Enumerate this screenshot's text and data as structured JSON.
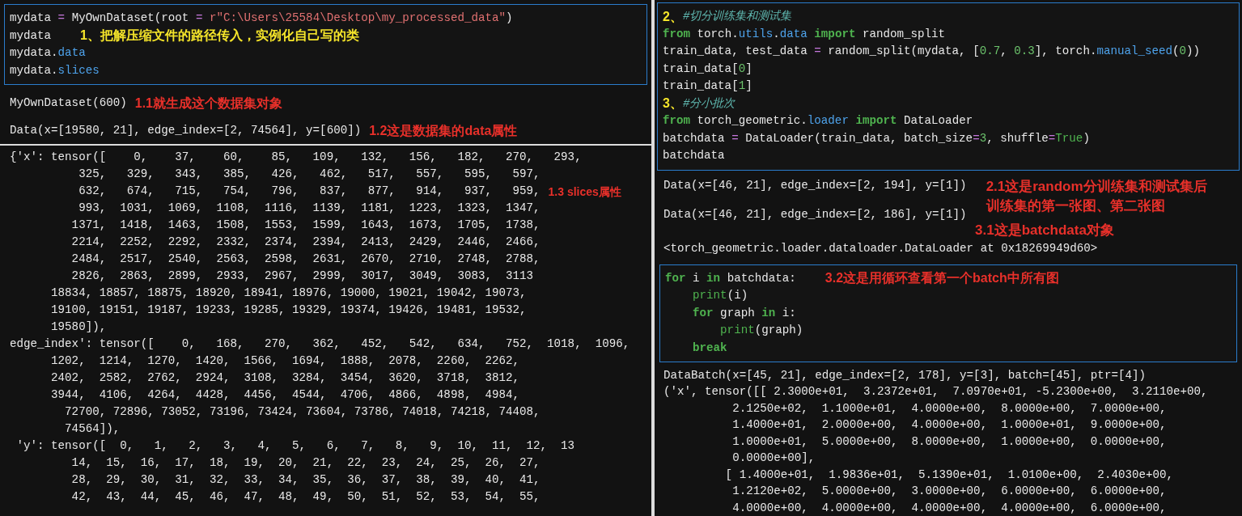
{
  "left": {
    "cell": {
      "lines": [
        {
          "tokens": [
            {
              "t": "mydata ",
              "kind": "plain"
            },
            {
              "t": "=",
              "kind": "op"
            },
            {
              "t": " MyOwnDataset(root ",
              "kind": "plain"
            },
            {
              "t": "=",
              "kind": "op"
            },
            {
              "t": " r\"C:\\Users\\25584\\Desktop\\my_processed_data\"",
              "kind": "str"
            },
            {
              "t": ")",
              "kind": "plain"
            }
          ]
        },
        {
          "tokens": [
            {
              "t": "mydata",
              "kind": "plain"
            }
          ],
          "note": {
            "text": "1、把解压缩文件的路径传入，实例化自己写的类",
            "color": "#f5e52a"
          }
        },
        {
          "tokens": [
            {
              "t": "mydata.",
              "kind": "plain"
            },
            {
              "t": "data",
              "kind": "attr"
            }
          ]
        },
        {
          "tokens": [
            {
              "t": "mydata.",
              "kind": "plain"
            },
            {
              "t": "slices",
              "kind": "attr"
            }
          ]
        }
      ]
    },
    "outputs": [
      {
        "text": "MyOwnDataset(600)",
        "note": {
          "text": "1.1就生成这个数据集对象",
          "color": "#e8302a"
        }
      },
      {
        "text": "Data(x=[19580, 21], edge_index=[2, 74564], y=[600])",
        "note": {
          "text": "1.2这是数据集的data属性",
          "color": "#e8302a"
        }
      }
    ],
    "slices": [
      {
        "text": "{'x': tensor([    0,    37,    60,    85,   109,   132,   156,   182,   270,   293,"
      },
      {
        "text": "          325,   329,   343,   385,   426,   462,   517,   557,   595,   597,"
      },
      {
        "text": "          632,   674,   715,   754,   796,   837,   877,   914,   937,   959,",
        "note": {
          "text": "1.3 slices属性",
          "color": "#e8302a"
        }
      },
      {
        "text": "          993,  1031,  1069,  1108,  1116,  1139,  1181,  1223,  1323,  1347,"
      },
      {
        "text": "         1371,  1418,  1463,  1508,  1553,  1599,  1643,  1673,  1705,  1738,"
      },
      {
        "text": "         2214,  2252,  2292,  2332,  2374,  2394,  2413,  2429,  2446,  2466,"
      },
      {
        "text": "         2484,  2517,  2540,  2563,  2598,  2631,  2670,  2710,  2748,  2788,"
      },
      {
        "text": "         2826,  2863,  2899,  2933,  2967,  2999,  3017,  3049,  3083,  3113"
      },
      {
        "text": "      18834, 18857, 18875, 18920, 18941, 18976, 19000, 19021, 19042, 19073,"
      },
      {
        "text": "      19100, 19151, 19187, 19233, 19285, 19329, 19374, 19426, 19481, 19532,"
      },
      {
        "text": "      19580]),"
      },
      {
        "text": "edge_index': tensor([    0,   168,   270,   362,   452,   542,   634,   752,  1018,  1096,"
      },
      {
        "text": "      1202,  1214,  1270,  1420,  1566,  1694,  1888,  2078,  2260,  2262,"
      },
      {
        "text": "      2402,  2582,  2762,  2924,  3108,  3284,  3454,  3620,  3718,  3812,"
      },
      {
        "text": "      3944,  4106,  4264,  4428,  4456,  4544,  4706,  4866,  4898,  4984,"
      },
      {
        "text": "        72700, 72896, 73052, 73196, 73424, 73604, 73786, 74018, 74218, 74408,"
      },
      {
        "text": "        74564]),"
      },
      {
        "text": " 'y': tensor([  0,   1,   2,   3,   4,   5,   6,   7,   8,   9,  10,  11,  12,  13"
      },
      {
        "text": "         14,  15,  16,  17,  18,  19,  20,  21,  22,  23,  24,  25,  26,  27,"
      },
      {
        "text": "         28,  29,  30,  31,  32,  33,  34,  35,  36,  37,  38,  39,  40,  41,"
      },
      {
        "text": "         42,  43,  44,  45,  46,  47,  48,  49,  50,  51,  52,  53,  54,  55,"
      }
    ]
  },
  "right": {
    "cell": {
      "lines": [
        {
          "marker": "2、",
          "tokens": [
            {
              "t": "#切分训练集和测试集",
              "kind": "comment"
            }
          ]
        },
        {
          "tokens": [
            {
              "t": "from",
              "kind": "kw"
            },
            {
              "t": " torch.",
              "kind": "plain"
            },
            {
              "t": "utils",
              "kind": "attr"
            },
            {
              "t": ".",
              "kind": "plain"
            },
            {
              "t": "data ",
              "kind": "attr"
            },
            {
              "t": "import",
              "kind": "kw"
            },
            {
              "t": " random_split",
              "kind": "plain"
            }
          ]
        },
        {
          "tokens": [
            {
              "t": "train_data, test_data ",
              "kind": "plain"
            },
            {
              "t": "=",
              "kind": "op"
            },
            {
              "t": " random_split(mydata, [",
              "kind": "plain"
            },
            {
              "t": "0.7",
              "kind": "num"
            },
            {
              "t": ", ",
              "kind": "plain"
            },
            {
              "t": "0.3",
              "kind": "num"
            },
            {
              "t": "], torch.",
              "kind": "plain"
            },
            {
              "t": "manual_seed",
              "kind": "attr"
            },
            {
              "t": "(",
              "kind": "plain"
            },
            {
              "t": "0",
              "kind": "num"
            },
            {
              "t": "))",
              "kind": "plain"
            }
          ]
        },
        {
          "tokens": [
            {
              "t": "train_data[",
              "kind": "plain"
            },
            {
              "t": "0",
              "kind": "num"
            },
            {
              "t": "]",
              "kind": "plain"
            }
          ]
        },
        {
          "tokens": [
            {
              "t": "train_data[",
              "kind": "plain"
            },
            {
              "t": "1",
              "kind": "num"
            },
            {
              "t": "]",
              "kind": "plain"
            }
          ]
        },
        {
          "marker": "3、",
          "tokens": [
            {
              "t": "#分小批次",
              "kind": "comment"
            }
          ]
        },
        {
          "tokens": [
            {
              "t": "from",
              "kind": "kw"
            },
            {
              "t": " torch_geometric.",
              "kind": "plain"
            },
            {
              "t": "loader ",
              "kind": "attr"
            },
            {
              "t": "import",
              "kind": "kw"
            },
            {
              "t": " DataLoader",
              "kind": "plain"
            }
          ]
        },
        {
          "tokens": [
            {
              "t": "batchdata ",
              "kind": "plain"
            },
            {
              "t": "=",
              "kind": "op"
            },
            {
              "t": " DataLoader(train_data, batch_size",
              "kind": "plain"
            },
            {
              "t": "=",
              "kind": "op"
            },
            {
              "t": "3",
              "kind": "num"
            },
            {
              "t": ", shuffle",
              "kind": "plain"
            },
            {
              "t": "=",
              "kind": "op"
            },
            {
              "t": "True",
              "kind": "builtin"
            },
            {
              "t": ")",
              "kind": "plain"
            }
          ]
        },
        {
          "tokens": [
            {
              "t": "batchdata",
              "kind": "plain"
            }
          ]
        }
      ]
    },
    "split_outputs": {
      "lines": [
        "Data(x=[46, 21], edge_index=[2, 194], y=[1])",
        "Data(x=[46, 21], edge_index=[2, 186], y=[1])"
      ],
      "note": {
        "text": "2.1这是random分训练集和测试集后训练集的第一张图、第二张图",
        "color": "#e8302a"
      }
    },
    "loader_note": {
      "text": "3.1这是batchdata对象",
      "color": "#e8302a"
    },
    "loader_repr": "<torch_geometric.loader.dataloader.DataLoader at 0x18269949d60>",
    "loop_cell": {
      "lines": [
        {
          "tokens": [
            {
              "t": "for",
              "kind": "kw"
            },
            {
              "t": " i ",
              "kind": "plain"
            },
            {
              "t": "in",
              "kind": "kw"
            },
            {
              "t": " batchdata:",
              "kind": "plain"
            }
          ],
          "note": {
            "text": "3.2这是用循环查看第一个batch中所有图",
            "color": "#e8302a"
          }
        },
        {
          "tokens": [
            {
              "t": "    print",
              "kind": "builtin"
            },
            {
              "t": "(i)",
              "kind": "plain"
            }
          ]
        },
        {
          "tokens": [
            {
              "t": "    for",
              "kind": "kw"
            },
            {
              "t": " graph ",
              "kind": "plain"
            },
            {
              "t": "in",
              "kind": "kw"
            },
            {
              "t": " i:",
              "kind": "plain"
            }
          ]
        },
        {
          "tokens": [
            {
              "t": "        print",
              "kind": "builtin"
            },
            {
              "t": "(graph)",
              "kind": "plain"
            }
          ]
        },
        {
          "tokens": [
            {
              "t": "    break",
              "kind": "kw"
            }
          ]
        }
      ]
    },
    "loop_outputs": [
      "DataBatch(x=[45, 21], edge_index=[2, 178], y=[3], batch=[45], ptr=[4])",
      "('x', tensor([[ 2.3000e+01,  3.2372e+01,  7.0970e+01, -5.2300e+00,  3.2110e+00,",
      "          2.1250e+02,  1.1000e+01,  4.0000e+00,  8.0000e+00,  7.0000e+00,",
      "          1.4000e+01,  2.0000e+00,  4.0000e+00,  1.0000e+01,  9.0000e+00,",
      "          1.0000e+01,  5.0000e+00,  8.0000e+00,  1.0000e+00,  0.0000e+00,",
      "          0.0000e+00],",
      "         [ 1.4000e+01,  1.9836e+01,  5.1390e+01,  1.0100e+00,  2.4030e+00,",
      "          1.2120e+02,  5.0000e+00,  3.0000e+00,  6.0000e+00,  6.0000e+00,",
      "          4.0000e+00,  4.0000e+00,  4.0000e+00,  4.0000e+00,  6.0000e+00,"
    ]
  }
}
